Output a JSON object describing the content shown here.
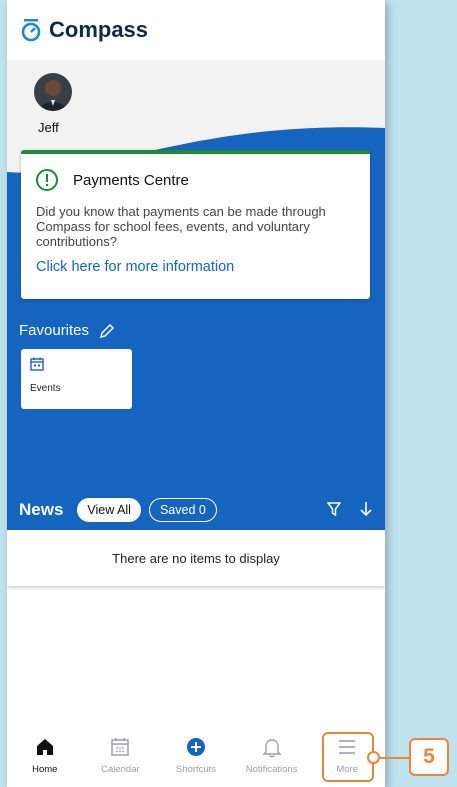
{
  "app": {
    "title": "Compass"
  },
  "user": {
    "name": "Jeff"
  },
  "payments_card": {
    "title": "Payments Centre",
    "body": "Did you know that payments can be made through Compass for school fees, events, and voluntary contributions?",
    "link": "Click here for more information"
  },
  "favourites": {
    "title": "Favourites",
    "tiles": [
      {
        "label": "Events"
      }
    ]
  },
  "news": {
    "title": "News",
    "view_all": "View All",
    "saved": "Saved 0",
    "empty_message": "There are no items to display"
  },
  "bottom_nav": {
    "items": [
      {
        "label": "Home",
        "icon": "home-icon"
      },
      {
        "label": "Calendar",
        "icon": "calendar-icon"
      },
      {
        "label": "Shortcuts",
        "icon": "plus-circle-icon"
      },
      {
        "label": "Notifications",
        "icon": "bell-icon"
      },
      {
        "label": "More",
        "icon": "menu-icon"
      }
    ]
  },
  "callout": {
    "step": "5"
  },
  "colors": {
    "brand_blue": "#1565c0",
    "accent_green": "#1f8a3c",
    "callout_orange": "#e8863a"
  }
}
